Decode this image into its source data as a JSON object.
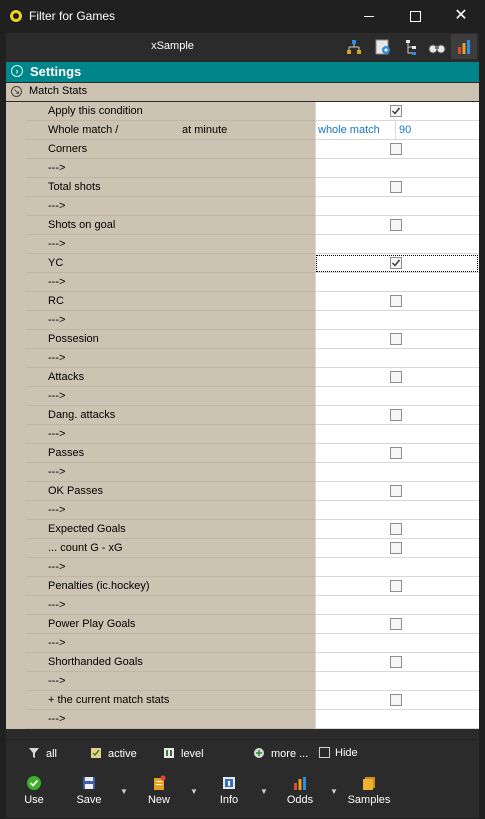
{
  "window": {
    "title": "Filter for Games"
  },
  "toolbar": {
    "sample_title": "xSample"
  },
  "settings": {
    "title": "Settings"
  },
  "category": {
    "label": "Match Stats"
  },
  "rows": [
    {
      "label": "Apply this condition",
      "checkbox": true,
      "checked": true
    },
    {
      "label": "Whole match /",
      "label2": "at minute",
      "text1": "whole match",
      "text2": "90"
    },
    {
      "label": "Corners",
      "checkbox": true,
      "checked": false
    },
    {
      "label": "--->"
    },
    {
      "label": "Total shots",
      "checkbox": true,
      "checked": false
    },
    {
      "label": "--->"
    },
    {
      "label": "Shots on goal",
      "checkbox": true,
      "checked": false
    },
    {
      "label": "--->"
    },
    {
      "label": "YC",
      "checkbox": true,
      "checked": true,
      "selected": true
    },
    {
      "label": "--->"
    },
    {
      "label": "RC",
      "checkbox": true,
      "checked": false
    },
    {
      "label": "--->"
    },
    {
      "label": "Possesion",
      "checkbox": true,
      "checked": false
    },
    {
      "label": "--->"
    },
    {
      "label": "Attacks",
      "checkbox": true,
      "checked": false
    },
    {
      "label": "--->"
    },
    {
      "label": "Dang. attacks",
      "checkbox": true,
      "checked": false
    },
    {
      "label": "--->"
    },
    {
      "label": "Passes",
      "checkbox": true,
      "checked": false
    },
    {
      "label": "--->"
    },
    {
      "label": "OK Passes",
      "checkbox": true,
      "checked": false
    },
    {
      "label": "--->"
    },
    {
      "label": "Expected Goals",
      "checkbox": true,
      "checked": false
    },
    {
      "label": "... count G - xG",
      "checkbox": true,
      "checked": false
    },
    {
      "label": "--->"
    },
    {
      "label": "Penalties (ic.hockey)",
      "checkbox": true,
      "checked": false
    },
    {
      "label": "--->"
    },
    {
      "label": "Power Play Goals",
      "checkbox": true,
      "checked": false
    },
    {
      "label": "--->"
    },
    {
      "label": "Shorthanded Goals",
      "checkbox": true,
      "checked": false
    },
    {
      "label": "--->"
    },
    {
      "label": "+ the current match stats",
      "checkbox": true,
      "checked": false
    },
    {
      "label": "--->"
    }
  ],
  "filter_bar": {
    "all": "all",
    "active": "active",
    "level": "level",
    "more": "more ...",
    "hide": "Hide"
  },
  "actions": {
    "use": "Use",
    "save": "Save",
    "new": "New",
    "info": "Info",
    "odds": "Odds",
    "samples": "Samples"
  },
  "colors": {
    "header_teal": "#00868a",
    "label_bg": "#cdc3b3",
    "value_text": "#1577c4",
    "window_bg": "#202020"
  }
}
